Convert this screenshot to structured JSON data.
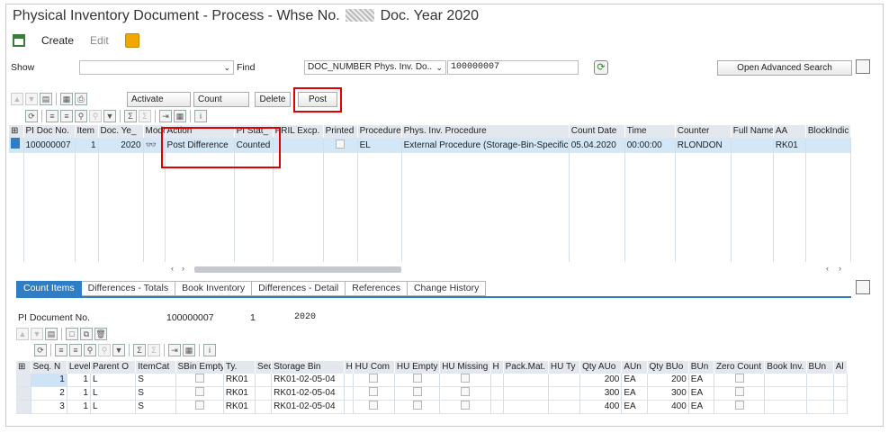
{
  "window": {
    "title_prefix": "Physical Inventory Document - Process - Whse No.",
    "title_suffix": "Doc. Year 2020"
  },
  "menu": {
    "create": "Create",
    "edit": "Edit"
  },
  "search": {
    "show_label": "Show",
    "show_value": "",
    "find_label": "Find",
    "field_select": "DOC_NUMBER Phys. Inv. Do..",
    "field_value": "100000007",
    "advanced_search": "Open Advanced Search"
  },
  "toolbar": {
    "activate": "Activate",
    "count": "Count",
    "delete": "Delete",
    "post": "Post"
  },
  "doc_grid": {
    "headers": [
      "PI Doc No.",
      "Item",
      "Doc. Ye_",
      "Mode",
      "Action",
      "PI Stat_",
      "PRIL Excp.",
      "Printed",
      "Procedure",
      "Phys. Inv. Procedure",
      "Count Date",
      "Time",
      "Counter",
      "Full Name",
      "AA",
      "BlockIndic"
    ],
    "rows": [
      [
        "100000007",
        "1",
        "2020",
        "",
        "Post Difference",
        "Counted",
        "",
        "",
        "EL",
        "External Procedure (Storage-Bin-Specific)",
        "05.04.2020",
        "00:00:00",
        "RLONDON",
        "",
        "RK01",
        ""
      ]
    ]
  },
  "tabs": [
    "Count Items",
    "Differences - Totals",
    "Book Inventory",
    "Differences - Detail",
    "References",
    "Change History"
  ],
  "detail": {
    "label": "PI Document No.",
    "doc_no": "100000007",
    "item": "1",
    "year": "2020"
  },
  "items_grid": {
    "headers": [
      "Seq. N",
      "Level",
      "Parent O",
      "ItemCat",
      "SBin Empty",
      "Ty.",
      "Sec",
      "Storage Bin",
      "H",
      "HU Com",
      "HU Empty",
      "HU Missing",
      "H",
      "Pack.Mat.",
      "HU Ty",
      "Qty AUo",
      "AUn",
      "Qty BUo",
      "BUn",
      "Zero Count",
      "Book Inv.",
      "BUn",
      "Al"
    ],
    "rows": [
      [
        "1",
        "1",
        "L",
        "S",
        "",
        "RK01",
        "",
        "RK01-02-05-04",
        "",
        "",
        "",
        "",
        "",
        "",
        "",
        "200",
        "EA",
        "200",
        "EA",
        "",
        "",
        "",
        ""
      ],
      [
        "2",
        "1",
        "L",
        "S",
        "",
        "RK01",
        "",
        "RK01-02-05-04",
        "",
        "",
        "",
        "",
        "",
        "",
        "",
        "300",
        "EA",
        "300",
        "EA",
        "",
        "",
        "",
        ""
      ],
      [
        "3",
        "1",
        "L",
        "S",
        "",
        "RK01",
        "",
        "RK01-02-05-04",
        "",
        "",
        "",
        "",
        "",
        "",
        "",
        "400",
        "EA",
        "400",
        "EA",
        "",
        "",
        "",
        ""
      ]
    ]
  }
}
